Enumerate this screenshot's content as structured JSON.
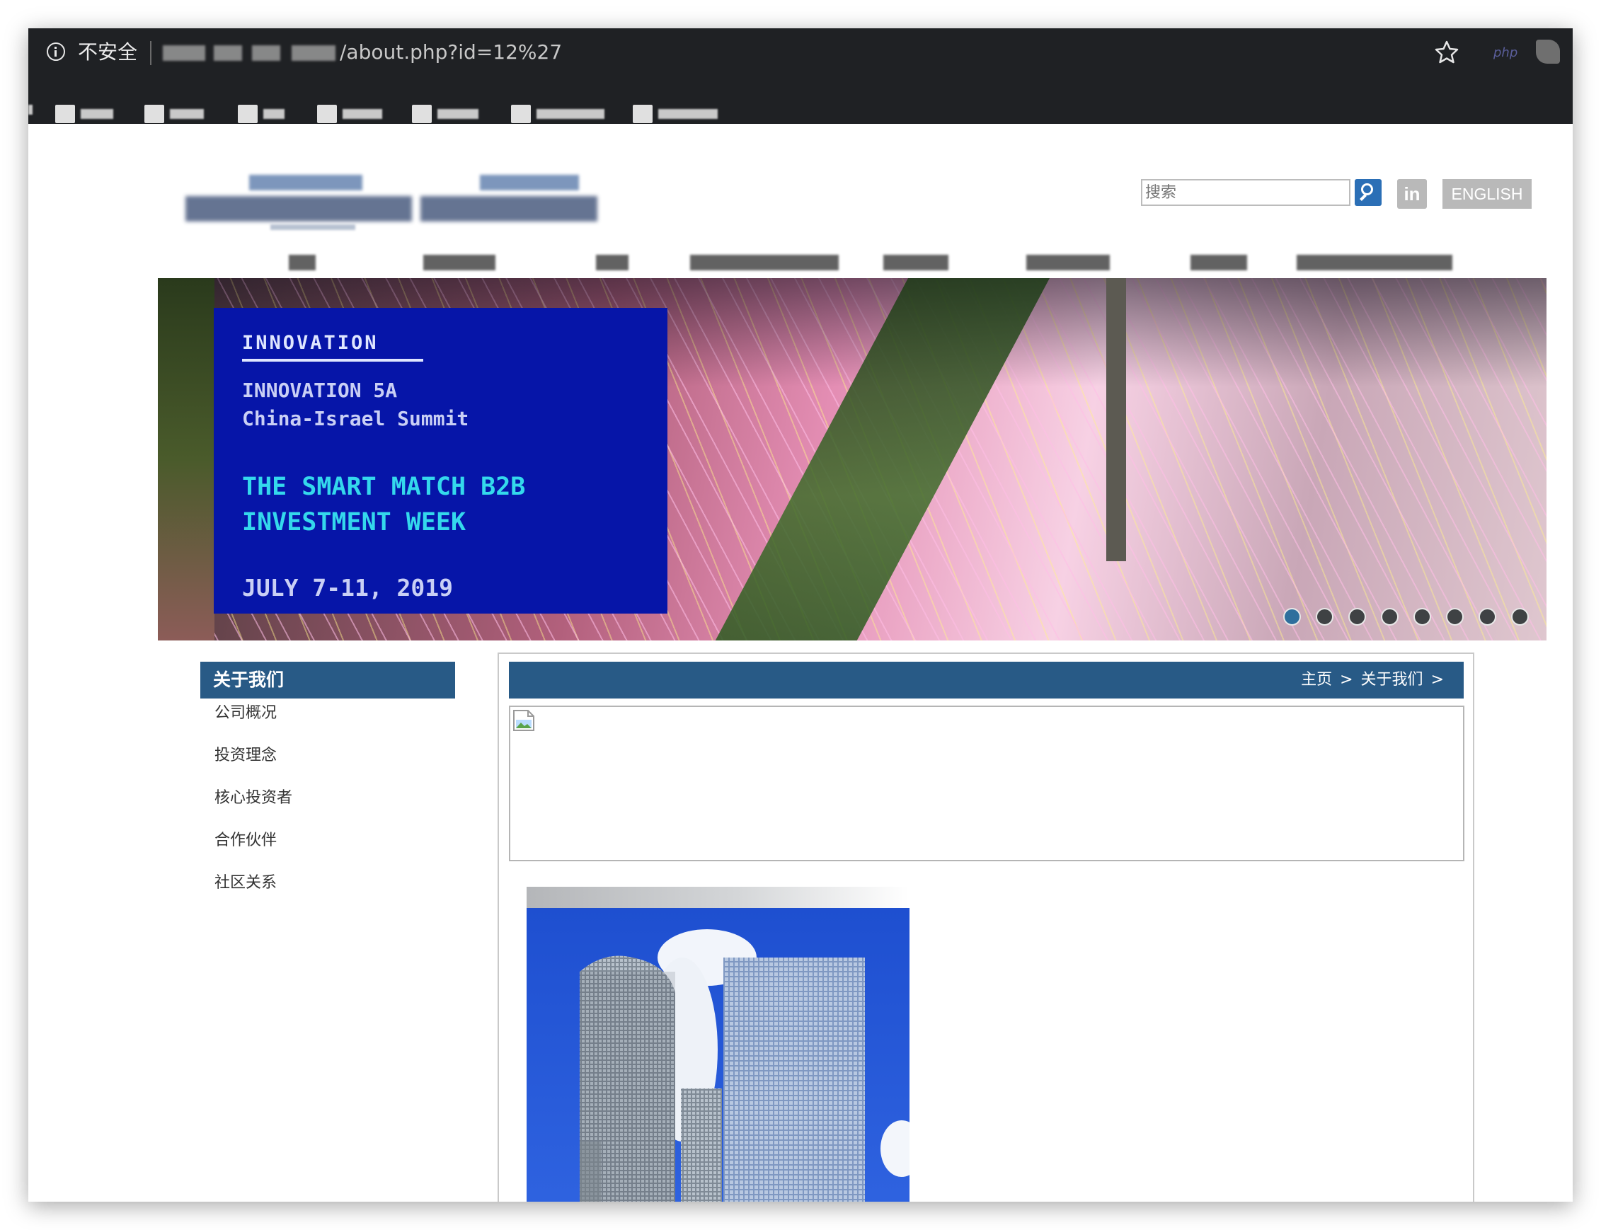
{
  "browser": {
    "security_label": "不安全",
    "url_path": "/about.php?id=12%27",
    "extension_label": "php"
  },
  "header": {
    "search_placeholder": "搜索",
    "linkedin_label": "in",
    "language_button": "ENGLISH"
  },
  "banner": {
    "eyebrow": "INNOVATION",
    "line1": "INNOVATION 5A",
    "line2": "China-Israel Summit",
    "headline1": "THE SMART MATCH B2B",
    "headline2": "INVESTMENT WEEK",
    "date": "JULY 7-11, 2019",
    "slide_count": 8,
    "active_slide": 1
  },
  "sidebar": {
    "title": "关于我们",
    "items": [
      {
        "label": "公司概况"
      },
      {
        "label": "投资理念"
      },
      {
        "label": "核心投资者"
      },
      {
        "label": "合作伙伴"
      },
      {
        "label": "社区关系"
      }
    ]
  },
  "breadcrumb": {
    "home": "主页",
    "separator": ">",
    "current": "关于我们"
  },
  "colors": {
    "chrome_bg": "#1f2124",
    "accent_blue": "#285a86",
    "promo_blue": "#0615a8",
    "promo_cyan": "#34d8ec"
  }
}
